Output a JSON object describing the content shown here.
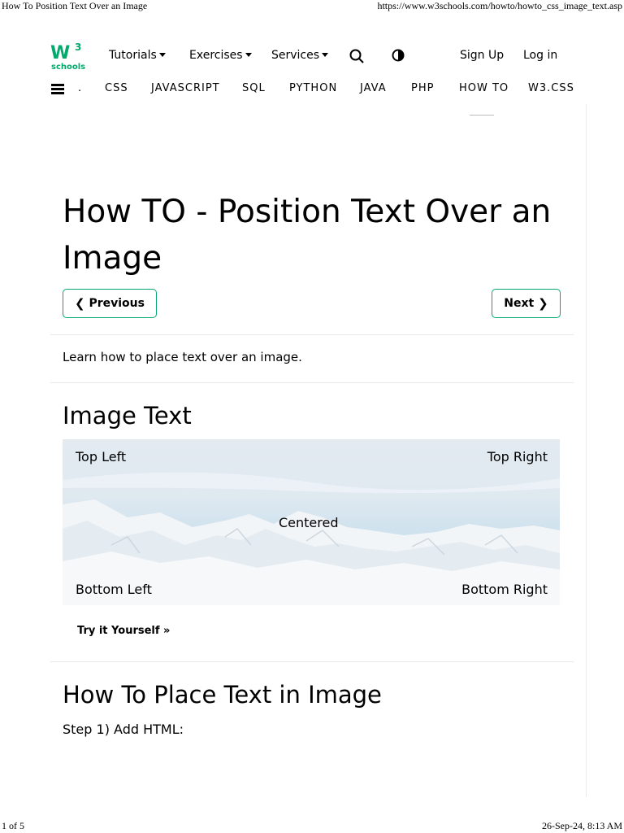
{
  "print_header": {
    "title": "How To Position Text Over an Image",
    "url": "https://www.w3schools.com/howto/howto_css_image_text.asp"
  },
  "print_footer": {
    "page": "1 of 5",
    "datetime": "26-Sep-24, 8:13 AM"
  },
  "brand": {
    "logo_text": "schools",
    "logo_mark": "W",
    "logo_sup": "3",
    "color": "#04AA6D"
  },
  "topnav": {
    "tutorials": "Tutorials",
    "exercises": "Exercises",
    "services": "Services",
    "sign_up": "Sign Up",
    "log_in": "Log in",
    "search_icon": "search-icon",
    "theme_icon": "contrast-icon"
  },
  "subnav": {
    "dot": ".",
    "items": [
      "CSS",
      "JAVASCRIPT",
      "SQL",
      "PYTHON",
      "JAVA",
      "PHP",
      "HOW TO",
      "W3.CSS"
    ]
  },
  "page": {
    "title": "How TO - Position Text Over an Image",
    "prev_label": "Previous",
    "next_label": "Next",
    "intro": "Learn how to place text over an image.",
    "section1_title": "Image Text",
    "overlay": {
      "top_left": "Top Left",
      "top_right": "Top Right",
      "centered": "Centered",
      "bottom_left": "Bottom Left",
      "bottom_right": "Bottom Right"
    },
    "try_label": "Try it Yourself »",
    "section2_title": "How To Place Text in Image",
    "step1": "Step 1) Add HTML:"
  },
  "colors": {
    "accent": "#04AA6D",
    "divider": "#e7e9eb"
  }
}
